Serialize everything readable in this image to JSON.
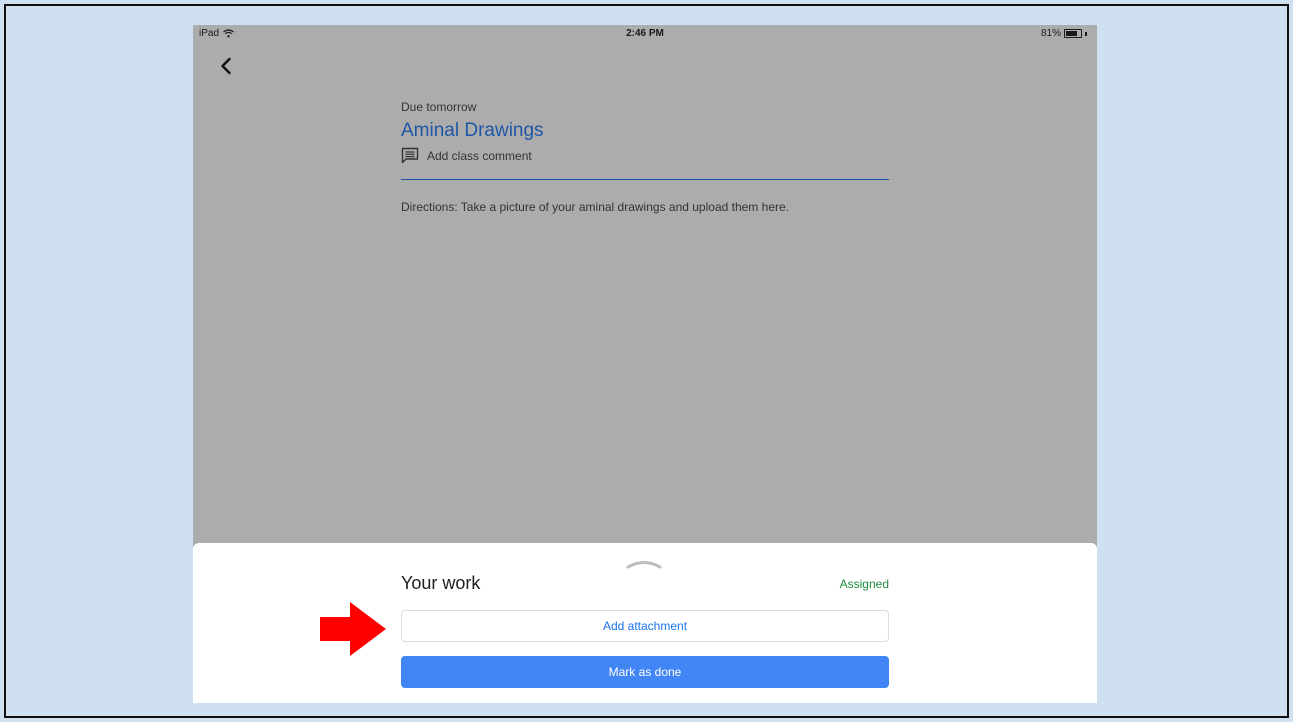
{
  "status_bar": {
    "device": "iPad",
    "time": "2:46 PM",
    "battery": "81%",
    "battery_level": 0.81
  },
  "assignment": {
    "due": "Due tomorrow",
    "title": "Aminal Drawings",
    "comment_label": "Add class comment",
    "directions": "Directions:  Take a picture of your aminal drawings and upload them here."
  },
  "your_work": {
    "heading": "Your work",
    "status": "Assigned",
    "add_attachment_label": "Add attachment",
    "mark_done_label": "Mark as done"
  },
  "colors": {
    "accent_blue": "#1a73e8",
    "button_blue": "#4285f4",
    "title_blue": "#1f57a8",
    "assigned_green": "#1e8e3e",
    "annotation_arrow_red": "#ff0000",
    "slide_background": "#cfe0f0"
  },
  "icons": [
    "wifi-icon",
    "battery-icon",
    "back-chevron-icon",
    "comment-icon",
    "sheet-handle-icon",
    "red-arrow-icon"
  ]
}
